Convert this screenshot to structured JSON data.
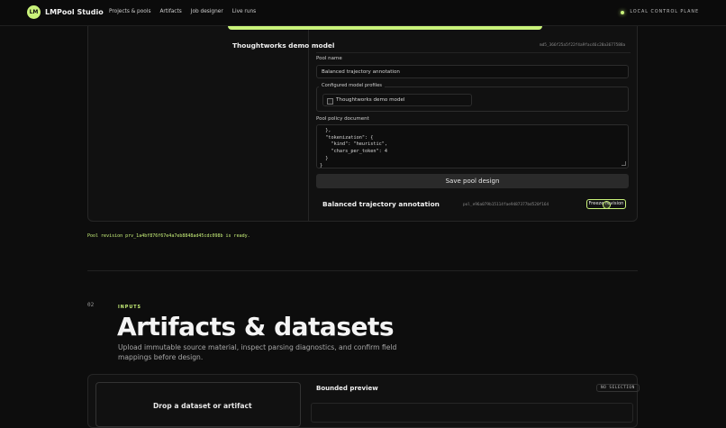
{
  "header": {
    "logo": "LM",
    "brand": "LMPool Studio",
    "nav": [
      "Projects & pools",
      "Artifacts",
      "Job designer",
      "Live runs"
    ],
    "status": "LOCAL CONTROL PLANE"
  },
  "model": {
    "title": "Thoughtworks demo model",
    "hash": "md5_366f25a5f22f4a9fac46c28a3677588a"
  },
  "pool": {
    "name_label": "Pool name",
    "name_value": "Balanced trajectory annotation",
    "profiles_label": "Configured model profiles",
    "profile_option": "Thoughtworks demo model",
    "policy_label": "Pool policy document",
    "policy_text": "    },\n  },\n  \"tokenization\": {\n    \"kind\": \"heuristic\",\n    \"chars_per_token\": 4\n  }\n}",
    "save_label": "Save pool design"
  },
  "design": {
    "title": "Balanced trajectory annotation",
    "hash": "pol_e96a079b15114fae9487377bd520f164",
    "freeze_label": "Freeze revision"
  },
  "ready_message": "Pool revision prv_1a4bf876f67e4a7eb8848ad45cdc098b is ready.",
  "section": {
    "number": "02",
    "eyebrow": "INPUTS",
    "title": "Artifacts & datasets",
    "subtitle": "Upload immutable source material, inspect parsing diagnostics, and confirm field mappings before design."
  },
  "upload": {
    "drop_title": "Drop a dataset or artifact"
  },
  "preview": {
    "title": "Bounded preview",
    "badge": "NO SELECTION"
  }
}
